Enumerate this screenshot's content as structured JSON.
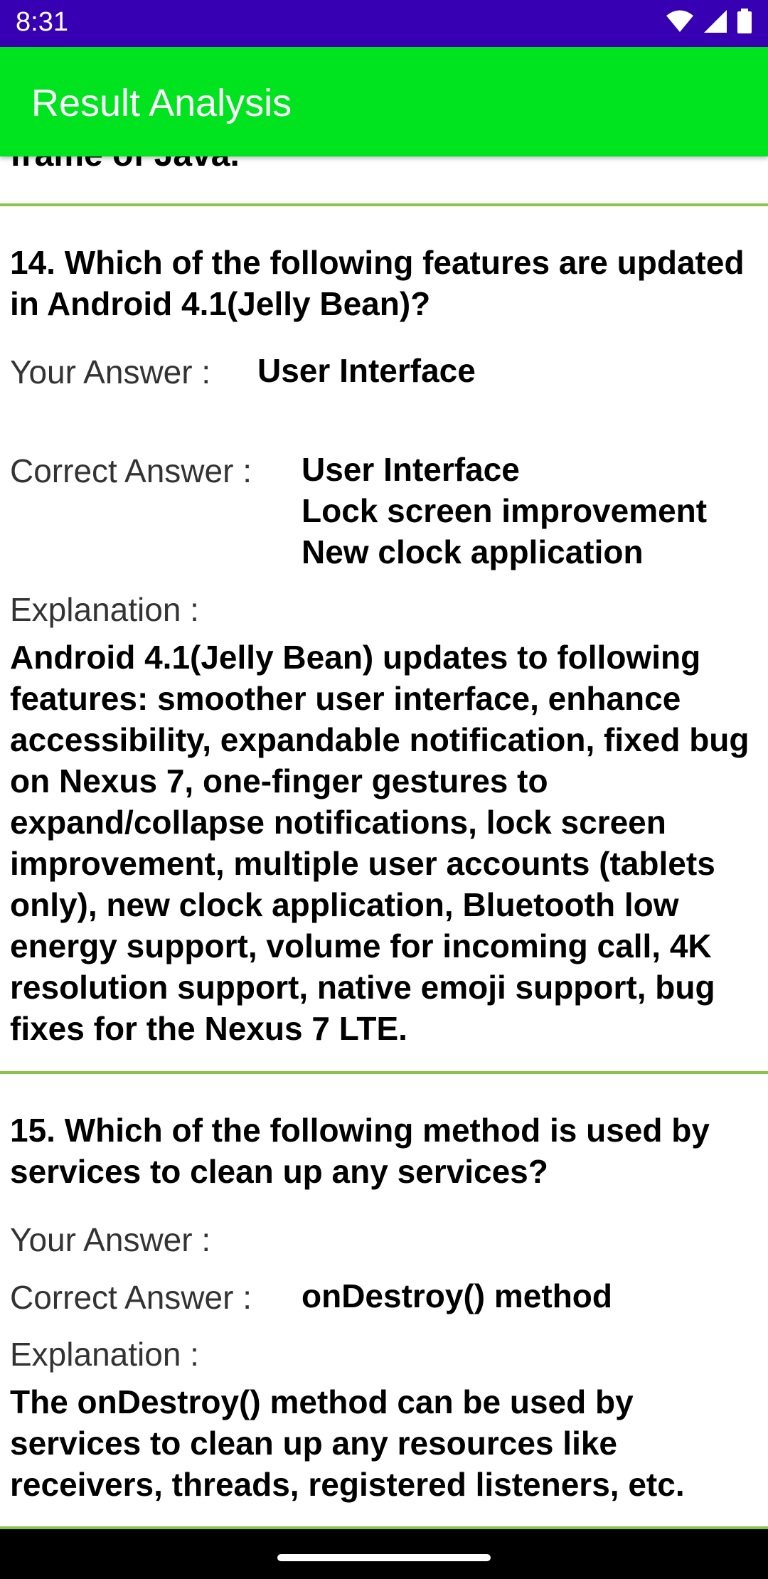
{
  "status_bar": {
    "time": "8:31",
    "icons": [
      "wifi-icon",
      "signal-icon",
      "battery-icon"
    ]
  },
  "app_bar": {
    "title": "Result Analysis"
  },
  "partial_text": "frame of Java.",
  "questions": [
    {
      "question": "14. Which of the following features are updated in Android 4.1(Jelly Bean)?",
      "your_answer_label": "Your Answer :",
      "your_answer": "User Interface",
      "correct_answer_label": "Correct Answer :",
      "correct_answers": [
        "User Interface",
        "Lock screen improvement",
        "New clock application"
      ],
      "explanation_label": "Explanation :",
      "explanation": "Android 4.1(Jelly Bean) updates to following features: smoother user interface, enhance accessibility, expandable notification, fixed bug on Nexus 7, one-finger gestures to expand/collapse notifications, lock screen improvement, multiple user accounts (tablets only), new clock application, Bluetooth low energy support, volume for incoming call, 4K resolution support, native emoji support, bug fixes for the Nexus 7 LTE."
    },
    {
      "question": "15. Which of the following method is used by services to clean up any services?",
      "your_answer_label": "Your Answer :",
      "your_answer": "",
      "correct_answer_label": "Correct Answer :",
      "correct_answers": [
        "onDestroy() method"
      ],
      "explanation_label": "Explanation :",
      "explanation": "The onDestroy() method can be used by services to clean up any resources like receivers, threads, registered listeners, etc."
    }
  ],
  "colors": {
    "status_bar": "#3700b3",
    "app_bar": "#00e41f",
    "divider": "#8bc34a"
  }
}
